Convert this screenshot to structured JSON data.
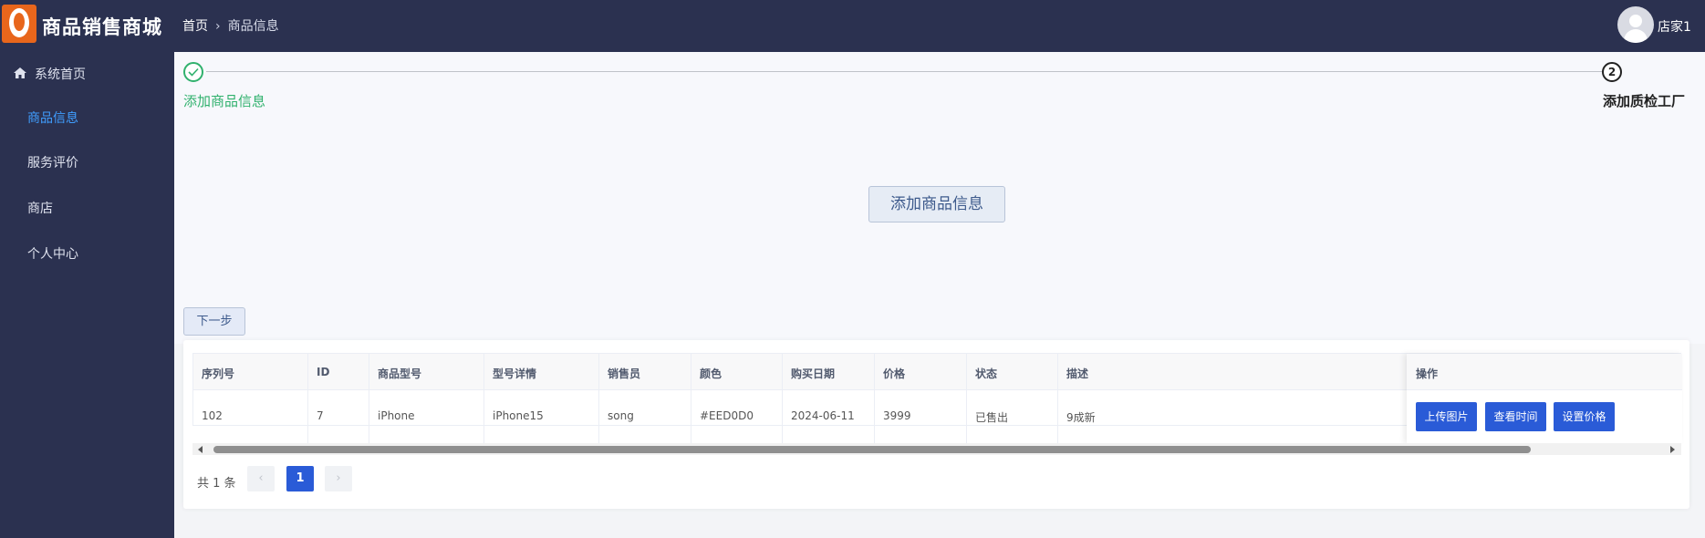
{
  "header": {
    "app_title": "商品销售商城",
    "breadcrumb": [
      "首页",
      "商品信息"
    ],
    "username": "店家1"
  },
  "sidebar": {
    "items": [
      {
        "label": "系统首页",
        "icon": "home-icon"
      },
      {
        "label": "商品信息",
        "active": true
      },
      {
        "label": "服务评价"
      },
      {
        "label": "商店"
      },
      {
        "label": "个人中心"
      }
    ]
  },
  "steps": [
    {
      "title": "添加商品信息",
      "status": "done"
    },
    {
      "number": "2",
      "title": "添加质检工厂",
      "status": "pending"
    }
  ],
  "main": {
    "add_button": "添加商品信息",
    "next_button": "下一步"
  },
  "table": {
    "columns": [
      "序列号",
      "ID",
      "商品型号",
      "型号详情",
      "销售员",
      "颜色",
      "购买日期",
      "价格",
      "状态",
      "描述"
    ],
    "operations_header": "操作",
    "rows": [
      {
        "cells": [
          "102",
          "7",
          "iPhone",
          "iPhone15",
          "song",
          "#EED0D0",
          "2024-06-11",
          "3999",
          "已售出",
          "9成新"
        ]
      }
    ],
    "row_actions": [
      "上传图片",
      "查看时间",
      "设置价格"
    ]
  },
  "pagination": {
    "total": "共 1 条",
    "prev": "‹",
    "current": "1",
    "next": "›"
  },
  "colors": {
    "header_bg": "#2b3150",
    "sidebar_bg": "#2b3150",
    "active_menu": "#409eff",
    "step_done": "#30b16d",
    "primary_button": "#2a5bd7"
  }
}
